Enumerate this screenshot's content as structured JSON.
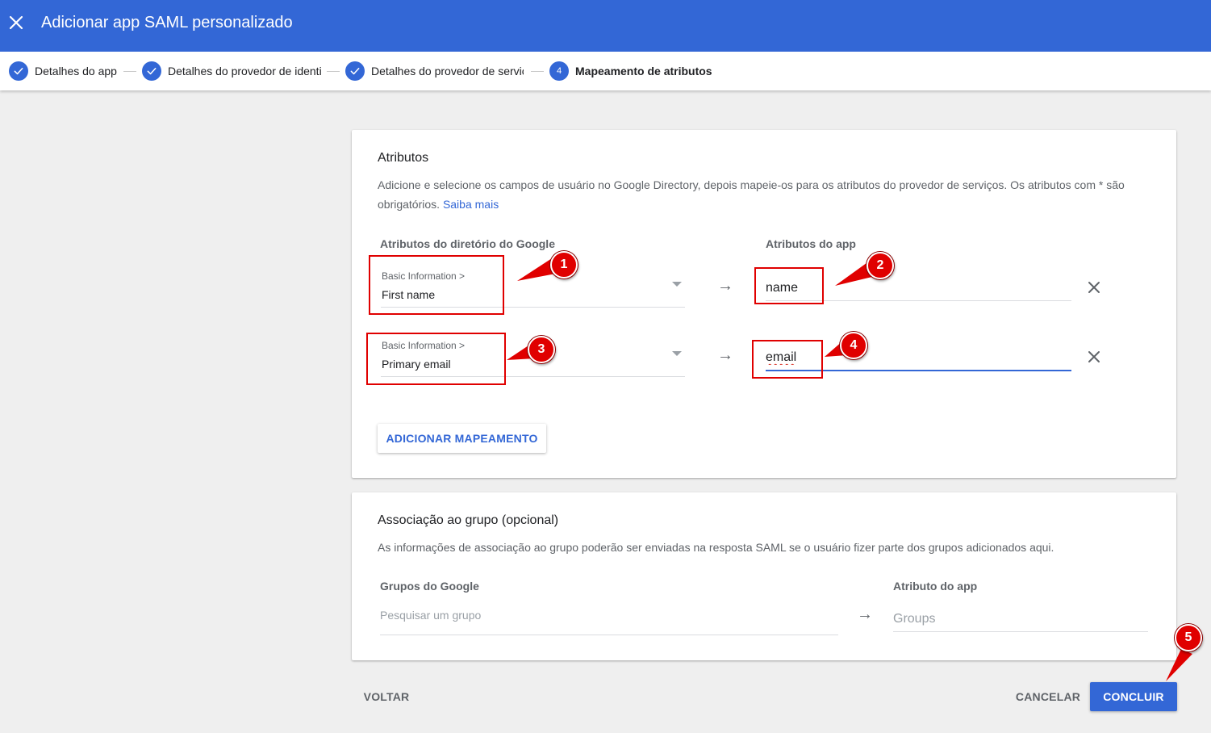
{
  "header": {
    "title": "Adicionar app SAML personalizado",
    "close_icon": "close-icon"
  },
  "stepper": {
    "steps": [
      {
        "label": "Detalhes do app",
        "state": "done"
      },
      {
        "label": "Detalhes do provedor de identi",
        "state": "done"
      },
      {
        "label": "Detalhes do provedor de serviç",
        "state": "done"
      },
      {
        "label": "Mapeamento de atributos",
        "state": "active",
        "number": "4"
      }
    ]
  },
  "attributes_card": {
    "title": "Atributos",
    "description": "Adicione e selecione os campos de usuário no Google Directory, depois mapeie-os para os atributos do provedor de serviços. Os atributos com * são obrigatórios.",
    "learn_more": "Saiba mais",
    "col_google": "Atributos do diretório do Google",
    "col_app": "Atributos do app",
    "mappings": [
      {
        "category": "Basic Information >",
        "field": "First name",
        "app_attribute": "name"
      },
      {
        "category": "Basic Information >",
        "field": "Primary email",
        "app_attribute": "email"
      }
    ],
    "arrow": "→",
    "add_button": "ADICIONAR MAPEAMENTO"
  },
  "group_card": {
    "title": "Associação ao grupo (opcional)",
    "description": "As informações de associação ao grupo poderão ser enviadas na resposta SAML se o usuário fizer parte dos grupos adicionados aqui.",
    "col_groups": "Grupos do Google",
    "col_app": "Atributo do app",
    "search_placeholder": "Pesquisar um grupo",
    "app_placeholder": "Groups",
    "arrow": "→"
  },
  "footer": {
    "back": "VOLTAR",
    "cancel": "CANCELAR",
    "finish": "CONCLUIR"
  },
  "annotations": {
    "markers": [
      "1",
      "2",
      "3",
      "4",
      "5"
    ]
  },
  "colors": {
    "primary": "#3367d6",
    "annotation_red": "#e00000",
    "background": "#efefef"
  }
}
